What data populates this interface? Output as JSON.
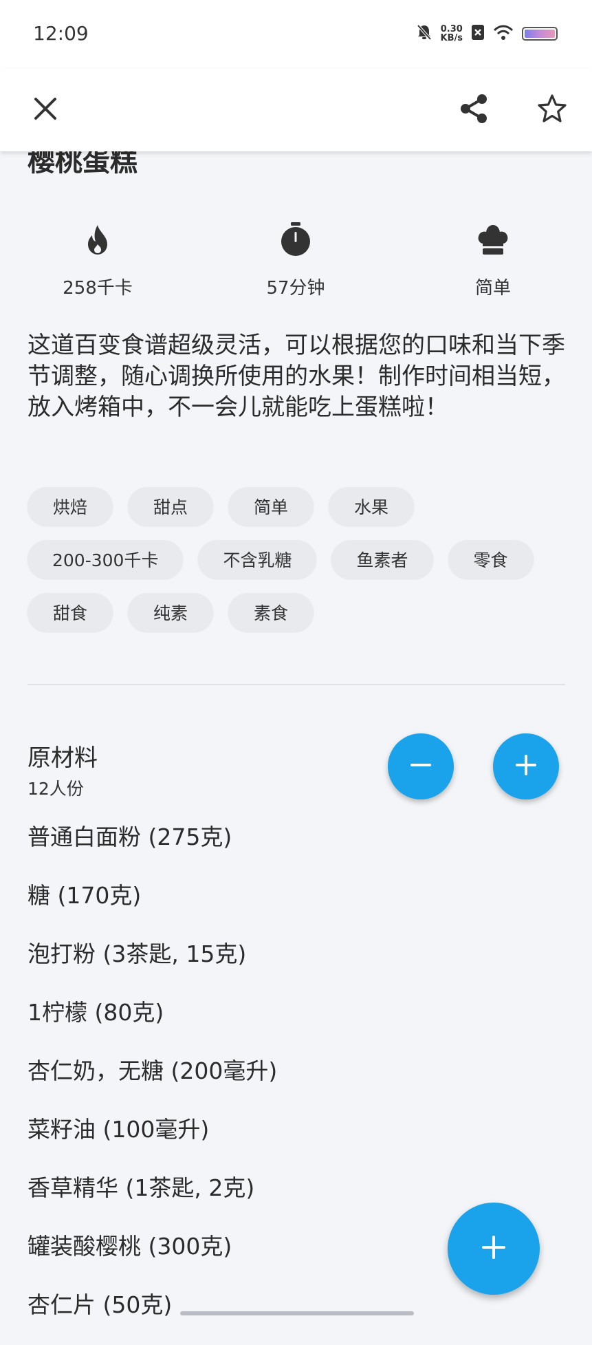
{
  "status_bar": {
    "time": "12:09",
    "net_speed_value": "0.30",
    "net_speed_unit": "KB/s"
  },
  "toolbar": {
    "close_icon": "close-icon",
    "share_icon": "share-icon",
    "favorite_icon": "star-outline-icon"
  },
  "recipe": {
    "title": "樱桃蛋糕",
    "stats": [
      {
        "icon": "flame-icon",
        "label": "258千卡"
      },
      {
        "icon": "stopwatch-icon",
        "label": "57分钟"
      },
      {
        "icon": "chef-hat-icon",
        "label": "简单"
      }
    ],
    "description": "这道百变食谱超级灵活，可以根据您的口味和当下季节调整，随心调换所使用的水果！制作时间相当短，放入烤箱中，不一会儿就能吃上蛋糕啦！",
    "tags": [
      [
        "烘焙",
        "甜点",
        "简单",
        "水果"
      ],
      [
        "200-300千卡",
        "不含乳糖",
        "鱼素者",
        "零食"
      ],
      [
        "甜食",
        "纯素",
        "素食"
      ]
    ]
  },
  "ingredients": {
    "title": "原材料",
    "servings": "12人份",
    "decrease_icon": "minus-icon",
    "increase_icon": "plus-icon",
    "items": [
      "普通白面粉 (275克)",
      "糖 (170克)",
      "泡打粉 (3茶匙, 15克)",
      "1柠檬 (80克)",
      "杏仁奶，无糖 (200毫升)",
      "菜籽油 (100毫升)",
      "香草精华 (1茶匙, 2克)",
      "罐装酸樱桃 (300克)",
      "杏仁片 (50克)"
    ]
  },
  "fab": {
    "icon": "plus-icon"
  },
  "colors": {
    "accent": "#1aa3ea",
    "background": "#f3f5f8",
    "chip": "#e8eaee"
  }
}
